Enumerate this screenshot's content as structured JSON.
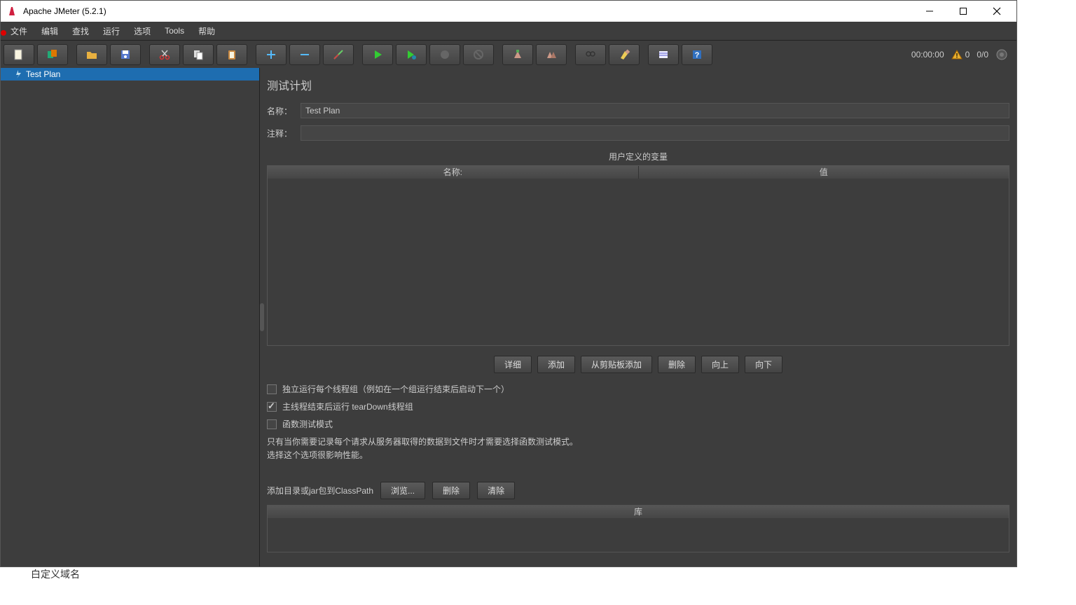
{
  "window": {
    "title": "Apache JMeter (5.2.1)"
  },
  "menu": {
    "file": "文件",
    "edit": "编辑",
    "search": "查找",
    "run": "运行",
    "options": "选项",
    "tools": "Tools",
    "help": "帮助"
  },
  "status": {
    "time": "00:00:00",
    "warn_count": "0",
    "counter": "0/0"
  },
  "tree": {
    "root": "Test Plan"
  },
  "panel": {
    "title": "测试计划",
    "name_label": "名称：",
    "name_value": "Test Plan",
    "comment_label": "注释：",
    "comment_value": "",
    "vars_header": "用户定义的变量",
    "col_name": "名称:",
    "col_value": "值",
    "btn_detail": "详细",
    "btn_add": "添加",
    "btn_paste": "从剪贴板添加",
    "btn_delete": "删除",
    "btn_up": "向上",
    "btn_down": "向下",
    "cb_serial": "独立运行每个线程组（例如在一个组运行结束后启动下一个）",
    "cb_teardown": "主线程结束后运行 tearDown线程组",
    "cb_func": "函数测试模式",
    "info1": "只有当你需要记录每个请求从服务器取得的数据到文件时才需要选择函数测试模式。",
    "info2": "选择这个选项很影响性能。",
    "classpath_label": "添加目录或jar包到ClassPath",
    "btn_browse": "浏览...",
    "btn_cp_delete": "删除",
    "btn_clear": "清除",
    "lib_col": "库"
  },
  "bottom": {
    "fragment": "白定义域名"
  }
}
